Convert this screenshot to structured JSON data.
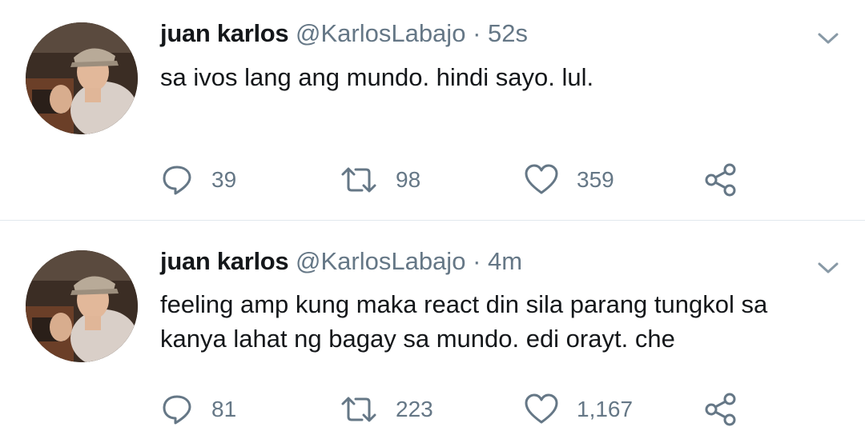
{
  "tweets": [
    {
      "display_name": "juan karlos",
      "handle": "@KarlosLabajo",
      "separator": "·",
      "time": "52s",
      "text": "sa ivos lang ang mundo. hindi sayo. lul.",
      "replies": "39",
      "retweets": "98",
      "likes": "359"
    },
    {
      "display_name": "juan karlos",
      "handle": "@KarlosLabajo",
      "separator": "·",
      "time": "4m",
      "text": "feeling amp kung maka react din sila parang tungkol sa kanya lahat ng bagay sa mundo. edi orayt. che",
      "replies": "81",
      "retweets": "223",
      "likes": "1,167"
    }
  ],
  "icons": {
    "reply": "reply-icon",
    "retweet": "retweet-icon",
    "like": "heart-icon",
    "share": "share-icon",
    "caret": "chevron-down-icon"
  },
  "colors": {
    "text": "#14171a",
    "secondary": "#657786",
    "divider": "#e1e8ed"
  }
}
